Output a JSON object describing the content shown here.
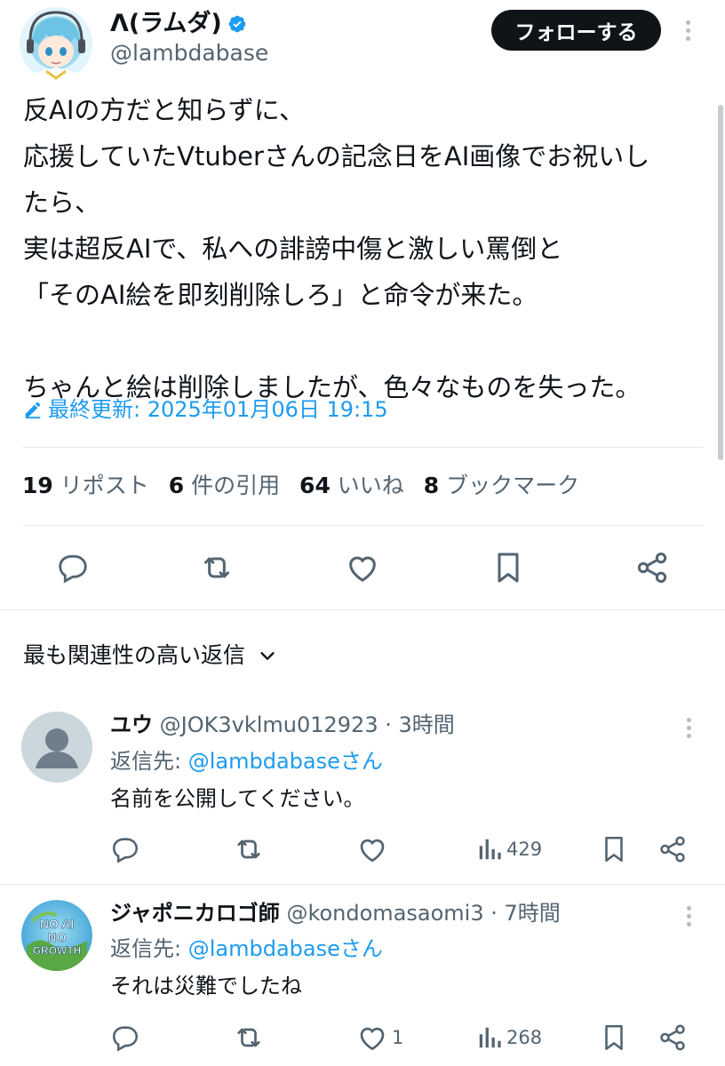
{
  "post": {
    "author_name": "Λ(ラムダ)",
    "handle": "@lambdabase",
    "follow_label": "フォローする",
    "lines": [
      "反AIの方だと知らずに、",
      "応援していたVtuberさんの記念日をAI画像でお祝いし",
      "たら、",
      "実は超反AIで、私への誹謗中傷と激しい罵倒と",
      "「そのAI絵を即刻削除しろ」と命令が来た。",
      "",
      "ちゃんと絵は削除しましたが、色々なものを失った。"
    ],
    "edited_label": "最終更新: 2025年01月06日 19:15",
    "stats": [
      {
        "count": "19",
        "label": "リポスト"
      },
      {
        "count": "6",
        "label": "件の引用"
      },
      {
        "count": "64",
        "label": "いいね"
      },
      {
        "count": "8",
        "label": "ブックマーク"
      }
    ]
  },
  "section_title": "最も関連性の高い返信",
  "replies": [
    {
      "name": "ユウ",
      "handle": "@JOK3vklmu012923",
      "time": "· 3時間",
      "reply_prefix": "返信先: ",
      "reply_link": "@lambdabaseさん",
      "text": "名前を公開してください。",
      "like_count": "",
      "views": "429"
    },
    {
      "name": "ジャポニカロゴ師",
      "handle": "@kondomasaomi3",
      "time": "· 7時間",
      "reply_prefix": "返信先: ",
      "reply_link": "@lambdabaseさん",
      "text": "それは災難でしたね",
      "like_count": "1",
      "views": "268",
      "avatar_text": [
        "NO AI",
        "NO",
        "GROWTH"
      ]
    }
  ],
  "colors": {
    "accent": "#1d9bf0",
    "text": "#0f1419",
    "muted": "#536471",
    "divider": "#e5e9ec"
  }
}
